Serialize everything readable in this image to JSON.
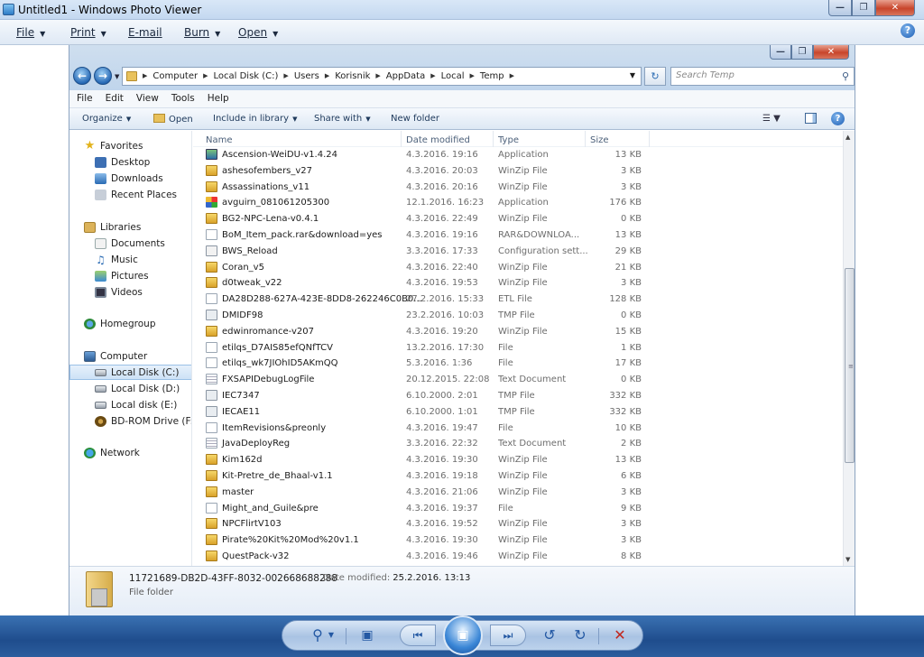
{
  "photo_viewer": {
    "title": "Untitled1 - Windows Photo Viewer",
    "menu": [
      {
        "label": "File",
        "has_dropdown": true
      },
      {
        "label": "Print",
        "has_dropdown": true
      },
      {
        "label": "E-mail",
        "has_dropdown": false
      },
      {
        "label": "Burn",
        "has_dropdown": true
      },
      {
        "label": "Open",
        "has_dropdown": true
      }
    ],
    "controls": [
      "zoom-icon",
      "actual-size-icon",
      "previous-icon",
      "slideshow-icon",
      "next-icon",
      "rotate-counterclockwise-icon",
      "rotate-clockwise-icon",
      "delete-icon"
    ]
  },
  "explorer": {
    "breadcrumbs": [
      "Computer",
      "Local Disk (C:)",
      "Users",
      "Korisnik",
      "AppData",
      "Local",
      "Temp"
    ],
    "search_placeholder": "Search Temp",
    "menu": [
      "File",
      "Edit",
      "View",
      "Tools",
      "Help"
    ],
    "commands": {
      "organize": "Organize",
      "open": "Open",
      "include": "Include in library",
      "share": "Share with",
      "new_folder": "New folder"
    },
    "nav": {
      "favorites": "Favorites",
      "desktop": "Desktop",
      "downloads": "Downloads",
      "recent": "Recent Places",
      "libraries": "Libraries",
      "documents": "Documents",
      "music": "Music",
      "pictures": "Pictures",
      "videos": "Videos",
      "homegroup": "Homegroup",
      "computer": "Computer",
      "local_c": "Local Disk (C:)",
      "local_d": "Local Disk (D:)",
      "local_e": "Local disk (E:)",
      "bd_rom": "BD-ROM Drive (F:) B",
      "network": "Network"
    },
    "columns": {
      "name": "Name",
      "date": "Date modified",
      "type": "Type",
      "size": "Size"
    },
    "files": [
      {
        "name": "Ascension-WeiDU-v1.4.24",
        "date": "4.3.2016. 19:16",
        "type": "Application",
        "size": "13 KB",
        "icon": "app"
      },
      {
        "name": "ashesofembers_v27",
        "date": "4.3.2016. 20:03",
        "type": "WinZip File",
        "size": "3 KB",
        "icon": "zip"
      },
      {
        "name": "Assassinations_v11",
        "date": "4.3.2016. 20:16",
        "type": "WinZip File",
        "size": "3 KB",
        "icon": "zip"
      },
      {
        "name": "avguirn_081061205300",
        "date": "12.1.2016. 16:23",
        "type": "Application",
        "size": "176 KB",
        "icon": "multi"
      },
      {
        "name": "BG2-NPC-Lena-v0.4.1",
        "date": "4.3.2016. 22:49",
        "type": "WinZip File",
        "size": "0 KB",
        "icon": "zip"
      },
      {
        "name": "BoM_Item_pack.rar&download=yes",
        "date": "4.3.2016. 19:16",
        "type": "RAR&DOWNLOA...",
        "size": "13 KB",
        "icon": "gen"
      },
      {
        "name": "BWS_Reload",
        "date": "3.3.2016. 17:33",
        "type": "Configuration sett...",
        "size": "29 KB",
        "icon": "cfg"
      },
      {
        "name": "Coran_v5",
        "date": "4.3.2016. 22:40",
        "type": "WinZip File",
        "size": "21 KB",
        "icon": "zip"
      },
      {
        "name": "d0tweak_v22",
        "date": "4.3.2016. 19:53",
        "type": "WinZip File",
        "size": "3 KB",
        "icon": "zip"
      },
      {
        "name": "DA28D288-627A-423E-8DD8-262246C0B0...",
        "date": "27.2.2016. 15:33",
        "type": "ETL File",
        "size": "128 KB",
        "icon": "gen"
      },
      {
        "name": "DMIDF98",
        "date": "23.2.2016. 10:03",
        "type": "TMP File",
        "size": "0 KB",
        "icon": "tmp"
      },
      {
        "name": "edwinromance-v207",
        "date": "4.3.2016. 19:20",
        "type": "WinZip File",
        "size": "15 KB",
        "icon": "zip"
      },
      {
        "name": "etilqs_D7AIS85efQNfTCV",
        "date": "13.2.2016. 17:30",
        "type": "File",
        "size": "1 KB",
        "icon": "gen"
      },
      {
        "name": "etilqs_wk7JIOhID5AKmQQ",
        "date": "5.3.2016. 1:36",
        "type": "File",
        "size": "17 KB",
        "icon": "gen"
      },
      {
        "name": "FXSAPIDebugLogFile",
        "date": "20.12.2015. 22:08",
        "type": "Text Document",
        "size": "0 KB",
        "icon": "txt"
      },
      {
        "name": "IEC7347",
        "date": "6.10.2000. 2:01",
        "type": "TMP File",
        "size": "332 KB",
        "icon": "tmp"
      },
      {
        "name": "IECAE11",
        "date": "6.10.2000. 1:01",
        "type": "TMP File",
        "size": "332 KB",
        "icon": "tmp"
      },
      {
        "name": "ItemRevisions&preonly",
        "date": "4.3.2016. 19:47",
        "type": "File",
        "size": "10 KB",
        "icon": "gen"
      },
      {
        "name": "JavaDeployReg",
        "date": "3.3.2016. 22:32",
        "type": "Text Document",
        "size": "2 KB",
        "icon": "txt"
      },
      {
        "name": "Kim162d",
        "date": "4.3.2016. 19:30",
        "type": "WinZip File",
        "size": "13 KB",
        "icon": "zip"
      },
      {
        "name": "Kit-Pretre_de_Bhaal-v1.1",
        "date": "4.3.2016. 19:18",
        "type": "WinZip File",
        "size": "6 KB",
        "icon": "zip"
      },
      {
        "name": "master",
        "date": "4.3.2016. 21:06",
        "type": "WinZip File",
        "size": "3 KB",
        "icon": "zip"
      },
      {
        "name": "Might_and_Guile&pre",
        "date": "4.3.2016. 19:37",
        "type": "File",
        "size": "9 KB",
        "icon": "gen"
      },
      {
        "name": "NPCFlirtV103",
        "date": "4.3.2016. 19:52",
        "type": "WinZip File",
        "size": "3 KB",
        "icon": "zip"
      },
      {
        "name": "Pirate%20Kit%20Mod%20v1.1",
        "date": "4.3.2016. 19:30",
        "type": "WinZip File",
        "size": "3 KB",
        "icon": "zip"
      },
      {
        "name": "QuestPack-v32",
        "date": "4.3.2016. 19:46",
        "type": "WinZip File",
        "size": "8 KB",
        "icon": "zip"
      }
    ],
    "details": {
      "name": "11721689-DB2D-43FF-8032-002668688288",
      "modified_label": "Date modified:",
      "modified_value": "25.2.2016. 13:13",
      "type": "File folder"
    }
  }
}
